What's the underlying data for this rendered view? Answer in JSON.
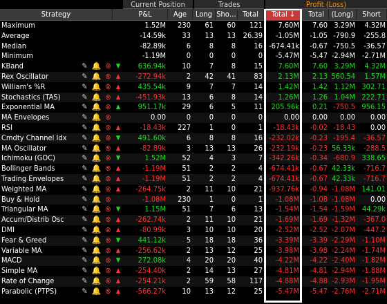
{
  "groups": {
    "current_position": "Current Position",
    "trades": "Trades",
    "profit_loss": "Profit (Loss)"
  },
  "headers": {
    "strategy": "Strategy",
    "pl": "P&L",
    "age": "Age",
    "long": "Long",
    "short": "Sho…",
    "trades_total": "Total",
    "total": "Total ↓",
    "pl_total": "Total",
    "pl_long": "(Long)",
    "pl_short": "Short"
  },
  "summary": [
    {
      "name": "Maximum",
      "pl": "1.52M",
      "age": "230",
      "long": "61",
      "short": "60",
      "tt": "121",
      "total": "7.60M",
      "pt": "7.60",
      "plong": "3.29M",
      "pshort": "4.32M",
      "pl_c": "w",
      "t_c": "w",
      "pt_c": "w",
      "plong_c": "w",
      "pshort_c": "w"
    },
    {
      "name": "Average",
      "pl": "-14.59k",
      "age": "33",
      "long": "13",
      "short": "13",
      "tt": "26.39",
      "total": "-1.05M",
      "pt": "-1.05",
      "plong": "-790.9",
      "pshort": "-255.8",
      "pl_c": "w",
      "t_c": "w",
      "pt_c": "w",
      "plong_c": "w",
      "pshort_c": "w"
    },
    {
      "name": "Median",
      "pl": "-82.89k",
      "age": "6",
      "long": "8",
      "short": "8",
      "tt": "16",
      "total": "-674.41k",
      "pt": "-0.67",
      "plong": "-750.5",
      "pshort": "-36.57",
      "pl_c": "w",
      "t_c": "w",
      "pt_c": "w",
      "plong_c": "w",
      "pshort_c": "w"
    },
    {
      "name": "Minimum",
      "pl": "-1.19M",
      "age": "0",
      "long": "0",
      "short": "0",
      "tt": "0",
      "total": "-5.47M",
      "pt": "-5.47",
      "plong": "-2.94M",
      "pshort": "-2.71M",
      "pl_c": "w",
      "t_c": "w",
      "pt_c": "w",
      "plong_c": "w",
      "pshort_c": "w"
    }
  ],
  "rows": [
    {
      "name": "KBand",
      "arrow": "▼",
      "arr_c": "g",
      "pl": "636.94k",
      "pl_c": "g",
      "age": "10",
      "long": "7",
      "short": "8",
      "tt": "15",
      "total": "7.60M",
      "t_c": "g",
      "pt": "7.60",
      "plong": "3.29M",
      "pshort": "4.32M",
      "pt_c": "g",
      "plong_c": "g",
      "pshort_c": "g",
      "ic3": "⊗"
    },
    {
      "name": "Rex Oscillator",
      "arrow": "▲",
      "arr_c": "r",
      "pl": "-272.94k",
      "pl_c": "r",
      "age": "2",
      "long": "42",
      "short": "41",
      "tt": "83",
      "total": "2.13M",
      "t_c": "g",
      "pt": "2.13",
      "plong": "560.54",
      "pshort": "1.57M",
      "pt_c": "g",
      "plong_c": "g",
      "pshort_c": "g",
      "ic3": "⊗"
    },
    {
      "name": "William's %R",
      "arrow": "▲",
      "arr_c": "r",
      "pl": "435.54k",
      "pl_c": "g",
      "age": "9",
      "long": "7",
      "short": "7",
      "tt": "14",
      "total": "1.42M",
      "t_c": "g",
      "pt": "1.42",
      "plong": "1.12M",
      "pshort": "302.71",
      "pt_c": "g",
      "plong_c": "g",
      "pshort_c": "g",
      "ic3": "⊗"
    },
    {
      "name": "Stochastics (TAS)",
      "arrow": "▲",
      "arr_c": "r",
      "pl": "-451.93k",
      "pl_c": "r",
      "age": "13",
      "long": "6",
      "short": "8",
      "tt": "14",
      "total": "1.26M",
      "t_c": "g",
      "pt": "1.26",
      "plong": "1.04M",
      "pshort": "222.71",
      "pt_c": "g",
      "plong_c": "g",
      "pshort_c": "g",
      "ic3": "⊗"
    },
    {
      "name": "Exponential MA",
      "arrow": "▲",
      "arr_c": "g",
      "pl": "951.17k",
      "pl_c": "g",
      "age": "29",
      "long": "6",
      "short": "5",
      "tt": "11",
      "total": "205.56k",
      "t_c": "g",
      "pt": "0.21",
      "plong": "-750.5",
      "pshort": "956.15",
      "pt_c": "g",
      "plong_c": "r",
      "pshort_c": "g",
      "ic3": "⊗"
    },
    {
      "name": "MA Envelopes",
      "arrow": "",
      "arr_c": "w",
      "pl": "0.00",
      "pl_c": "w",
      "age": "0",
      "long": "0",
      "short": "0",
      "tt": "0",
      "total": "0.00",
      "t_c": "w",
      "pt": "0.00",
      "plong": "0.00",
      "pshort": "0.00",
      "pt_c": "w",
      "plong_c": "w",
      "pshort_c": "w",
      "ic3": "⊗"
    },
    {
      "name": "RSI",
      "arrow": "▲",
      "arr_c": "r",
      "pl": "-18.43k",
      "pl_c": "r",
      "age": "227",
      "long": "1",
      "short": "0",
      "tt": "1",
      "total": "-18.43k",
      "t_c": "r",
      "pt": "-0.02",
      "plong": "-18.43",
      "pshort": "0.00",
      "pt_c": "r",
      "plong_c": "r",
      "pshort_c": "w",
      "ic3": "⊗"
    },
    {
      "name": "Cmdty Channel Idx",
      "arrow": "▼",
      "arr_c": "g",
      "pl": "491.60k",
      "pl_c": "g",
      "age": "6",
      "long": "8",
      "short": "8",
      "tt": "16",
      "total": "-232.02k",
      "t_c": "r",
      "pt": "-0.23",
      "plong": "-195.4",
      "pshort": "-36.57",
      "pt_c": "r",
      "plong_c": "r",
      "pshort_c": "r",
      "ic3": "⊗"
    },
    {
      "name": "MA Oscillator",
      "arrow": "▲",
      "arr_c": "r",
      "pl": "-82.89k",
      "pl_c": "r",
      "age": "3",
      "long": "13",
      "short": "13",
      "tt": "26",
      "total": "-232.19k",
      "t_c": "r",
      "pt": "-0.23",
      "plong": "56.33k",
      "pshort": "-288.5",
      "pt_c": "r",
      "plong_c": "g",
      "pshort_c": "r",
      "ic3": "⊗"
    },
    {
      "name": "Ichimoku (GOC)",
      "arrow": "▼",
      "arr_c": "g",
      "pl": "1.52M",
      "pl_c": "g",
      "age": "52",
      "long": "4",
      "short": "3",
      "tt": "7",
      "total": "-342.26k",
      "t_c": "r",
      "pt": "-0.34",
      "plong": "-680.9",
      "pshort": "338.65",
      "pt_c": "r",
      "plong_c": "r",
      "pshort_c": "g",
      "ic3": "⊗"
    },
    {
      "name": "Bollinger Bands",
      "arrow": "▲",
      "arr_c": "r",
      "pl": "-1.19M",
      "pl_c": "r",
      "age": "51",
      "long": "2",
      "short": "2",
      "tt": "4",
      "total": "-674.41k",
      "t_c": "r",
      "pt": "-0.67",
      "plong": "42.33k",
      "pshort": "-716.7",
      "pt_c": "r",
      "plong_c": "g",
      "pshort_c": "r",
      "ic3": "⊗"
    },
    {
      "name": "Trading Envelopes",
      "arrow": "▲",
      "arr_c": "r",
      "pl": "-1.19M",
      "pl_c": "r",
      "age": "51",
      "long": "2",
      "short": "2",
      "tt": "4",
      "total": "-674.41k",
      "t_c": "r",
      "pt": "-0.67",
      "plong": "42.33k",
      "pshort": "-716.7",
      "pt_c": "r",
      "plong_c": "g",
      "pshort_c": "r",
      "ic3": "⊗"
    },
    {
      "name": "Weighted MA",
      "arrow": "▲",
      "arr_c": "r",
      "pl": "-264.75k",
      "pl_c": "r",
      "age": "2",
      "long": "11",
      "short": "10",
      "tt": "21",
      "total": "-937.76k",
      "t_c": "r",
      "pt": "-0.94",
      "plong": "-1.08M",
      "pshort": "141.01",
      "pt_c": "r",
      "plong_c": "r",
      "pshort_c": "g",
      "ic3": "⊗"
    },
    {
      "name": "Buy & Hold",
      "arrow": "",
      "arr_c": "w",
      "pl": "-1.08M",
      "pl_c": "r",
      "age": "230",
      "long": "1",
      "short": "0",
      "tt": "1",
      "total": "-1.08M",
      "t_c": "r",
      "pt": "-1.08",
      "plong": "-1.08M",
      "pshort": "0.00",
      "pt_c": "r",
      "plong_c": "r",
      "pshort_c": "w",
      "ic3": "⊗"
    },
    {
      "name": "Triangular MA",
      "arrow": "▼",
      "arr_c": "g",
      "pl": "1.15M",
      "pl_c": "g",
      "age": "51",
      "long": "7",
      "short": "6",
      "tt": "13",
      "total": "-1.54M",
      "t_c": "r",
      "pt": "-1.54",
      "plong": "-1.59M",
      "pshort": "44.29k",
      "pt_c": "r",
      "plong_c": "r",
      "pshort_c": "g",
      "ic3": "⊗"
    },
    {
      "name": "Accum/Distrib Osc",
      "arrow": "▲",
      "arr_c": "r",
      "pl": "-262.74k",
      "pl_c": "r",
      "age": "2",
      "long": "11",
      "short": "10",
      "tt": "21",
      "total": "-1.69M",
      "t_c": "r",
      "pt": "-1.69",
      "plong": "-1.32M",
      "pshort": "-367.0",
      "pt_c": "r",
      "plong_c": "r",
      "pshort_c": "r",
      "ic3": "⊗"
    },
    {
      "name": "DMI",
      "arrow": "▲",
      "arr_c": "r",
      "pl": "-80.99k",
      "pl_c": "r",
      "age": "3",
      "long": "10",
      "short": "10",
      "tt": "20",
      "total": "-2.52M",
      "t_c": "r",
      "pt": "-2.52",
      "plong": "-2.07M",
      "pshort": "-447.2",
      "pt_c": "r",
      "plong_c": "r",
      "pshort_c": "r",
      "ic3": "⊗"
    },
    {
      "name": "Fear & Greed",
      "arrow": "▼",
      "arr_c": "g",
      "pl": "441.12k",
      "pl_c": "g",
      "age": "5",
      "long": "18",
      "short": "18",
      "tt": "36",
      "total": "-3.39M",
      "t_c": "r",
      "pt": "-3.39",
      "plong": "-2.29M",
      "pshort": "-1.10M",
      "pt_c": "r",
      "plong_c": "r",
      "pshort_c": "r",
      "ic3": "⊗"
    },
    {
      "name": "Variable MA",
      "arrow": "▲",
      "arr_c": "r",
      "pl": "-256.62k",
      "pl_c": "r",
      "age": "2",
      "long": "13",
      "short": "12",
      "tt": "25",
      "total": "-3.98M",
      "t_c": "r",
      "pt": "-3.98",
      "plong": "-2.24M",
      "pshort": "-1.74M",
      "pt_c": "r",
      "plong_c": "r",
      "pshort_c": "r",
      "ic3": "⊗"
    },
    {
      "name": "MACD",
      "arrow": "▼",
      "arr_c": "g",
      "pl": "272.08k",
      "pl_c": "g",
      "age": "4",
      "long": "20",
      "short": "20",
      "tt": "40",
      "total": "-4.22M",
      "t_c": "r",
      "pt": "-4.22",
      "plong": "-2.40M",
      "pshort": "-1.82M",
      "pt_c": "r",
      "plong_c": "r",
      "pshort_c": "r",
      "ic3": "⊗"
    },
    {
      "name": "Simple MA",
      "arrow": "▲",
      "arr_c": "r",
      "pl": "-254.40k",
      "pl_c": "r",
      "age": "2",
      "long": "14",
      "short": "13",
      "tt": "27",
      "total": "-4.81M",
      "t_c": "r",
      "pt": "-4.81",
      "plong": "-2.94M",
      "pshort": "-1.88M",
      "pt_c": "r",
      "plong_c": "r",
      "pshort_c": "r",
      "ic3": "⊗"
    },
    {
      "name": "Rate of Change",
      "arrow": "▲",
      "arr_c": "r",
      "pl": "-254.21k",
      "pl_c": "r",
      "age": "2",
      "long": "59",
      "short": "58",
      "tt": "117",
      "total": "-4.88M",
      "t_c": "r",
      "pt": "-4.88",
      "plong": "-2.93M",
      "pshort": "-1.95M",
      "pt_c": "r",
      "plong_c": "r",
      "pshort_c": "r",
      "ic3": "⊗"
    },
    {
      "name": "Parabolic (PTPS)",
      "arrow": "▲",
      "arr_c": "r",
      "pl": "-566.27k",
      "pl_c": "r",
      "age": "10",
      "long": "13",
      "short": "12",
      "tt": "25",
      "total": "-5.47M",
      "t_c": "r",
      "pt": "-5.47",
      "plong": "-2.76M",
      "pshort": "-2.71M",
      "pt_c": "r",
      "plong_c": "r",
      "pshort_c": "r",
      "ic3": "⊗"
    }
  ],
  "icons": {
    "edit": "pencil-icon",
    "alert": "bell-icon",
    "remove": "remove-circle-icon"
  }
}
